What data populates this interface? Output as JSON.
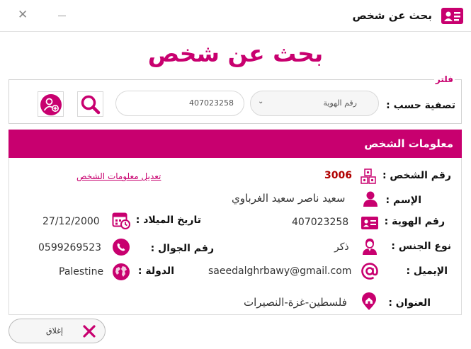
{
  "window": {
    "title": "بحث عن شخص"
  },
  "header": {
    "title": "بحث عن شخص"
  },
  "filter": {
    "legend": "فلتر",
    "label": "تصفية حسب :",
    "selected_option": "رقم الهوية",
    "search_value": "407023258"
  },
  "person_info": {
    "section_title": "معلومات الشخص",
    "edit_link": "تعديل معلومات الشخص",
    "fields": {
      "person_id": {
        "label": "رقم الشخص :",
        "value": "3006"
      },
      "name": {
        "label": "الإسم :",
        "value": "سعيد ناصر سعيد الغرباوي"
      },
      "id_number": {
        "label": "رقم الهوية :",
        "value": "407023258"
      },
      "gender": {
        "label": "نوع الجنس :",
        "value": "ذكر"
      },
      "email": {
        "label": "الإيميل :",
        "value": "saeedalghrbawy@gmail.com"
      },
      "address": {
        "label": "العنوان :",
        "value": "فلسطين-غزة-النصيرات"
      },
      "birth_date": {
        "label": "تاريخ الميلاد :",
        "value": "27/12/2000"
      },
      "mobile": {
        "label": "رقم الجوال :",
        "value": "0599269523"
      },
      "country": {
        "label": "الدولة :",
        "value": "Palestine"
      }
    }
  },
  "footer": {
    "close_label": "إغلاق"
  },
  "colors": {
    "accent": "#c8006f",
    "close_x": "#c8006f"
  }
}
